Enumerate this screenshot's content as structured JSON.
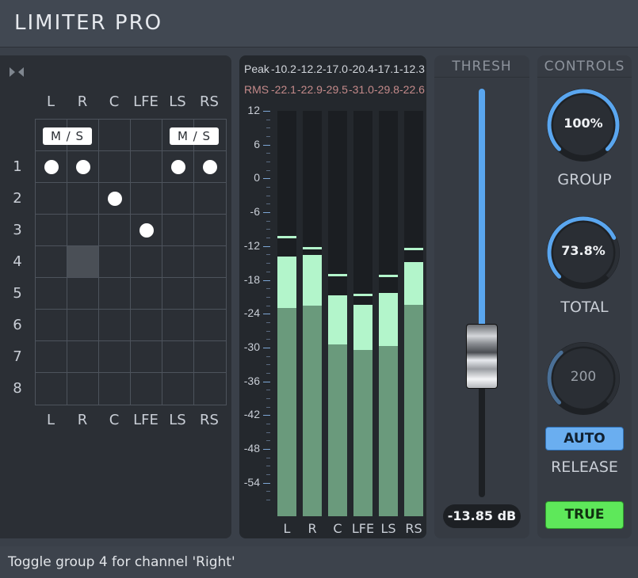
{
  "app": {
    "title": "LIMITER PRO"
  },
  "matrix": {
    "channels": [
      "L",
      "R",
      "C",
      "LFE",
      "LS",
      "RS"
    ],
    "groups": [
      "1",
      "2",
      "3",
      "4",
      "5",
      "6",
      "7",
      "8"
    ],
    "ms_label": "M / S",
    "ms_pairs": [
      [
        0,
        1
      ],
      [
        4,
        5
      ]
    ],
    "assignments": [
      {
        "channel": 0,
        "group": 0
      },
      {
        "channel": 1,
        "group": 0
      },
      {
        "channel": 2,
        "group": 1
      },
      {
        "channel": 3,
        "group": 2
      },
      {
        "channel": 4,
        "group": 0
      },
      {
        "channel": 5,
        "group": 0
      }
    ],
    "hover_cell": {
      "channel": 1,
      "group": 3
    }
  },
  "meters": {
    "peak_label": "Peak",
    "rms_label": "RMS",
    "peak_values": [
      "-10.2",
      "-12.2",
      "-17.0",
      "-20.4",
      "-17.1",
      "-12.3"
    ],
    "rms_values": [
      "-22.1",
      "-22.9",
      "-29.5",
      "-31.0",
      "-29.8",
      "-22.6"
    ],
    "scale_labels": [
      "12",
      "6",
      "0",
      "-6",
      "-12",
      "-18",
      "-24",
      "-30",
      "-36",
      "-42",
      "-48",
      "-54"
    ],
    "channels": [
      "L",
      "R",
      "C",
      "LFE",
      "LS",
      "RS"
    ],
    "peak_fill_db": [
      -13.8,
      -13.6,
      -20.8,
      -22.4,
      -20.3,
      -14.8
    ],
    "rms_fill_db": [
      -23.0,
      -22.5,
      -29.5,
      -30.5,
      -29.8,
      -22.4
    ],
    "hold_db": [
      -10.2,
      -12.2,
      -17.0,
      -20.4,
      -17.1,
      -12.3
    ],
    "rms_hold_db": [
      -22.1,
      null,
      null,
      null,
      null,
      null
    ],
    "range_db": [
      -60,
      12
    ],
    "colors": {
      "peak": "#b3f5cb",
      "rms": "#6a9a7c",
      "rms_text": "#c48a8a"
    }
  },
  "threshold": {
    "header": "THRESH",
    "value_text": "-13.85 dB",
    "value_db": -13.85,
    "range_db": [
      -60,
      12
    ],
    "accent": "#5aa6ef"
  },
  "controls": {
    "header": "CONTROLS",
    "group_knob": {
      "value": "100%",
      "fraction": 1.0,
      "label": "GROUP"
    },
    "total_knob": {
      "value": "73.8%",
      "fraction": 0.738,
      "label": "TOTAL"
    },
    "release_knob": {
      "value": "200",
      "fraction": 0.35,
      "label": "RELEASE"
    },
    "auto_label": "AUTO",
    "true_label": "TRUE",
    "accent": "#5aa6ef",
    "true_color": "#5ee85a"
  },
  "status": {
    "text": "Toggle group 4 for channel 'Right'"
  }
}
